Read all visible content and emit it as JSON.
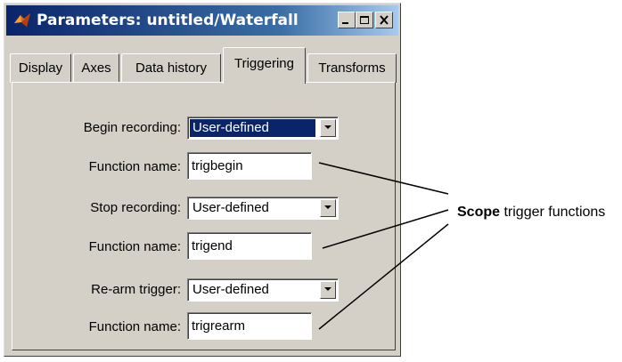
{
  "window": {
    "title": "Parameters: untitled/Waterfall",
    "icon": "matlab-icon",
    "controls": [
      "minimize-icon",
      "maximize-icon",
      "close-icon"
    ]
  },
  "tabs": [
    {
      "label": "Display"
    },
    {
      "label": "Axes"
    },
    {
      "label": "Data history"
    },
    {
      "label": "Triggering",
      "active": true
    },
    {
      "label": "Transforms"
    }
  ],
  "form": {
    "begin_recording": {
      "label": "Begin recording:",
      "value": "User-defined"
    },
    "begin_function": {
      "label": "Function name:",
      "value": "trigbegin"
    },
    "stop_recording": {
      "label": "Stop recording:",
      "value": "User-defined"
    },
    "stop_function": {
      "label": "Function name:",
      "value": "trigend"
    },
    "rearm_trigger": {
      "label": "Re-arm trigger:",
      "value": "User-defined"
    },
    "rearm_function": {
      "label": "Function name:",
      "value": "trigrearm"
    }
  },
  "annotation": {
    "bold": "Scope",
    "rest": " trigger functions"
  },
  "colors": {
    "dialog_bg": "#d4d0c8",
    "title_start": "#0a246a",
    "title_end": "#a6caf0",
    "selection": "#0a246a"
  }
}
